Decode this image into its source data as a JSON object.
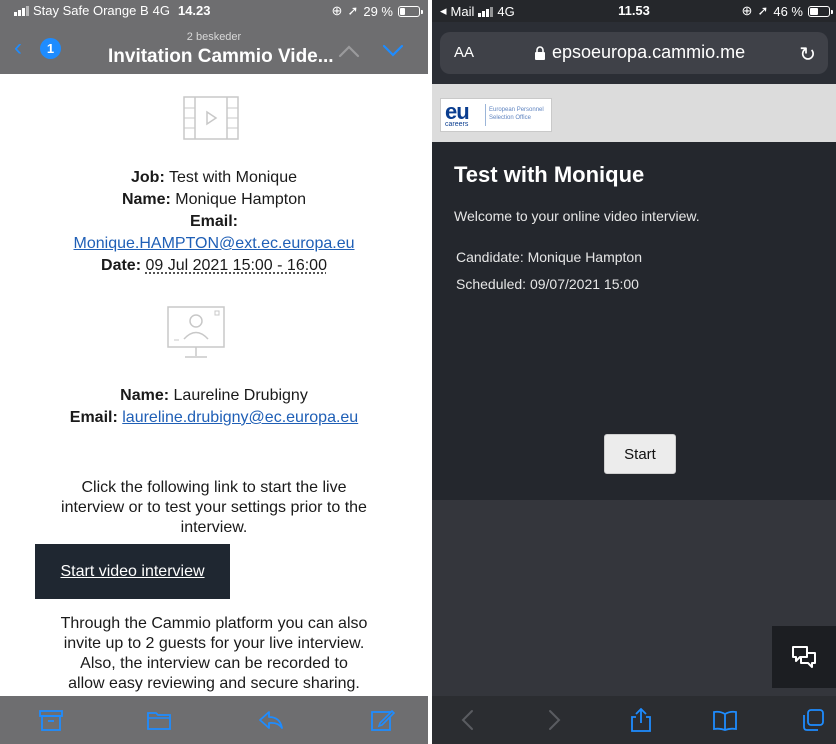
{
  "left": {
    "status": {
      "carrier": "Stay Safe Orange B",
      "network": "4G",
      "time": "14.23",
      "battery": "29 %"
    },
    "nav": {
      "back_count": "1",
      "subtitle": "2 beskeder",
      "title": "Invitation Cammio Vide..."
    },
    "job_label": "Job:",
    "job_value": "Test with Monique",
    "name_label": "Name:",
    "name_value": "Monique Hampton",
    "email_label": "Email:",
    "email_value": "Monique.HAMPTON@ext.ec.europa.eu",
    "date_label": "Date:",
    "date_value": "09 Jul 2021 15:00 - 16:00",
    "name2_label": "Name:",
    "name2_value": "Laureline Drubigny",
    "email2_label": "Email:",
    "email2_value": "laureline.drubigny@ec.europa.eu",
    "para1": [
      "Click the following link to start the live",
      "interview or to test your settings prior to the",
      "interview."
    ],
    "start_link": "Start video interview",
    "para2": [
      "Through the Cammio platform you can also",
      "invite up to 2 guests for your live interview.",
      "Also, the interview can be recorded to",
      "allow easy reviewing and secure sharing."
    ],
    "toolbar_icons": [
      "archive-icon",
      "folder-icon",
      "reply-icon",
      "compose-icon"
    ],
    "accent": "#1e8cff"
  },
  "right": {
    "status": {
      "back_app": "Mail",
      "network": "4G",
      "time": "11.53",
      "battery": "46 %"
    },
    "url": {
      "text_size": "AA",
      "domain": "epsoeuropa.cammio.me"
    },
    "logo": {
      "eu": "eu",
      "careers": "careers",
      "office_line1": "European Personnel",
      "office_line2": "Selection Office"
    },
    "page_title": "Test with Monique",
    "welcome": "Welcome to your online video interview.",
    "candidate": "Candidate: Monique Hampton",
    "scheduled": "Scheduled: 09/07/2021 15:00",
    "start_label": "Start",
    "toolbar_icons": [
      "back-icon",
      "forward-icon",
      "share-icon",
      "bookmarks-icon",
      "tabs-icon"
    ]
  }
}
